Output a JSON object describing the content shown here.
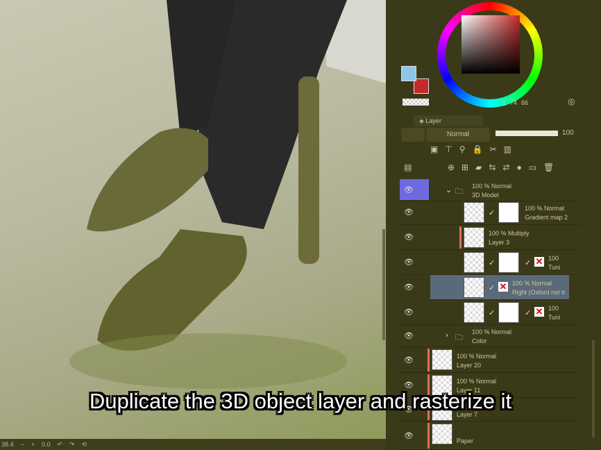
{
  "caption": "Duplicate the 3D object layer and rasterize it",
  "color": {
    "main": "#8ec6ea",
    "sub": "#c42a2a",
    "readout": {
      "a": "1",
      "b": "74",
      "c": "66"
    }
  },
  "layer_panel": {
    "tab_label": "Layer",
    "blend_mode": "Normal",
    "opacity": "100",
    "layers": [
      {
        "opacity": "100 %",
        "mode": "Normal",
        "name": "3D Model",
        "type": "folder"
      },
      {
        "opacity": "100 %",
        "mode": "Normal",
        "name": "Gradient map 2"
      },
      {
        "opacity": "100 %",
        "mode": "Multiply",
        "name": "Layer 3"
      },
      {
        "opacity": "100",
        "mode": "",
        "name": "Tuni"
      },
      {
        "opacity": "100 %",
        "mode": "Normal",
        "name": "Right (Oxford not tr"
      },
      {
        "opacity": "100",
        "mode": "",
        "name": "Tuni"
      },
      {
        "opacity": "100 %",
        "mode": "Normal",
        "name": "Color",
        "type": "folder"
      },
      {
        "opacity": "100 %",
        "mode": "Normal",
        "name": "Layer 20"
      },
      {
        "opacity": "100 %",
        "mode": "Normal",
        "name": "Layer 11"
      },
      {
        "opacity": "",
        "mode": "",
        "name": "Layer 7"
      },
      {
        "opacity": "",
        "mode": "",
        "name": "Paper"
      }
    ]
  },
  "bottom": {
    "zoom": "38.4",
    "minus": "−",
    "plus": "+",
    "angle": "0.0"
  }
}
